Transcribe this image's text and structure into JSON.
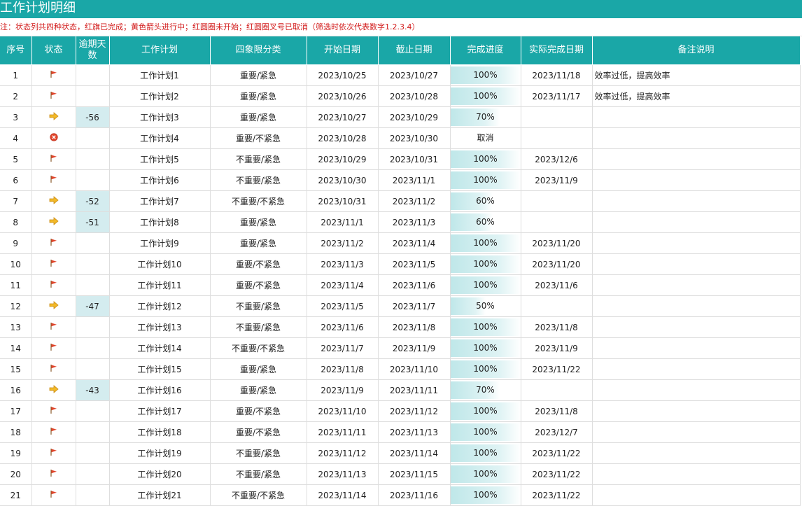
{
  "title": "工作计划明细",
  "note": "注：状态列共四种状态，红旗已完成；黄色箭头进行中；红圆圈未开始；红圆圈叉号已取消（筛选时依次代表数字1.2.3.4）",
  "headers": [
    "序号",
    "状态",
    "逾期天数",
    "工作计划",
    "四象限分类",
    "开始日期",
    "截止日期",
    "完成进度",
    "实际完成日期",
    "备注说明"
  ],
  "colors": {
    "header_bg": "#1aa7a7",
    "note_red": "#d21a1a",
    "overdue_bg": "#d4ecef",
    "progress_fill": "#bfe7e9"
  },
  "rows": [
    {
      "no": "1",
      "status": "flag-icon",
      "overdue": "",
      "plan": "工作计划1",
      "quadrant": "重要/紧急",
      "start": "2023/10/25",
      "end": "2023/10/27",
      "progress": "100%",
      "progress_value": 100,
      "actual": "2023/11/18",
      "remark": "效率过低，提高效率"
    },
    {
      "no": "2",
      "status": "flag-icon",
      "overdue": "",
      "plan": "工作计划2",
      "quadrant": "重要/紧急",
      "start": "2023/10/26",
      "end": "2023/10/28",
      "progress": "100%",
      "progress_value": 100,
      "actual": "2023/11/17",
      "remark": "效率过低，提高效率"
    },
    {
      "no": "3",
      "status": "arrow-icon",
      "overdue": "-56",
      "plan": "工作计划3",
      "quadrant": "重要/紧急",
      "start": "2023/10/27",
      "end": "2023/10/29",
      "progress": "70%",
      "progress_value": 70,
      "actual": "",
      "remark": ""
    },
    {
      "no": "4",
      "status": "cancel-icon",
      "overdue": "",
      "plan": "工作计划4",
      "quadrant": "重要/不紧急",
      "start": "2023/10/28",
      "end": "2023/10/30",
      "progress": "取消",
      "progress_value": 0,
      "actual": "",
      "remark": ""
    },
    {
      "no": "5",
      "status": "flag-icon",
      "overdue": "",
      "plan": "工作计划5",
      "quadrant": "不重要/紧急",
      "start": "2023/10/29",
      "end": "2023/10/31",
      "progress": "100%",
      "progress_value": 100,
      "actual": "2023/12/6",
      "remark": ""
    },
    {
      "no": "6",
      "status": "flag-icon",
      "overdue": "",
      "plan": "工作计划6",
      "quadrant": "不重要/紧急",
      "start": "2023/10/30",
      "end": "2023/11/1",
      "progress": "100%",
      "progress_value": 100,
      "actual": "2023/11/9",
      "remark": ""
    },
    {
      "no": "7",
      "status": "arrow-icon",
      "overdue": "-52",
      "plan": "工作计划7",
      "quadrant": "不重要/不紧急",
      "start": "2023/10/31",
      "end": "2023/11/2",
      "progress": "60%",
      "progress_value": 60,
      "actual": "",
      "remark": ""
    },
    {
      "no": "8",
      "status": "arrow-icon",
      "overdue": "-51",
      "plan": "工作计划8",
      "quadrant": "重要/紧急",
      "start": "2023/11/1",
      "end": "2023/11/3",
      "progress": "60%",
      "progress_value": 60,
      "actual": "",
      "remark": ""
    },
    {
      "no": "9",
      "status": "flag-icon",
      "overdue": "",
      "plan": "工作计划9",
      "quadrant": "重要/紧急",
      "start": "2023/11/2",
      "end": "2023/11/4",
      "progress": "100%",
      "progress_value": 100,
      "actual": "2023/11/20",
      "remark": ""
    },
    {
      "no": "10",
      "status": "flag-icon",
      "overdue": "",
      "plan": "工作计划10",
      "quadrant": "重要/不紧急",
      "start": "2023/11/3",
      "end": "2023/11/5",
      "progress": "100%",
      "progress_value": 100,
      "actual": "2023/11/20",
      "remark": ""
    },
    {
      "no": "11",
      "status": "flag-icon",
      "overdue": "",
      "plan": "工作计划11",
      "quadrant": "重要/不紧急",
      "start": "2023/11/4",
      "end": "2023/11/6",
      "progress": "100%",
      "progress_value": 100,
      "actual": "2023/11/6",
      "remark": ""
    },
    {
      "no": "12",
      "status": "arrow-icon",
      "overdue": "-47",
      "plan": "工作计划12",
      "quadrant": "不重要/紧急",
      "start": "2023/11/5",
      "end": "2023/11/7",
      "progress": "50%",
      "progress_value": 50,
      "actual": "",
      "remark": ""
    },
    {
      "no": "13",
      "status": "flag-icon",
      "overdue": "",
      "plan": "工作计划13",
      "quadrant": "不重要/紧急",
      "start": "2023/11/6",
      "end": "2023/11/8",
      "progress": "100%",
      "progress_value": 100,
      "actual": "2023/11/8",
      "remark": ""
    },
    {
      "no": "14",
      "status": "flag-icon",
      "overdue": "",
      "plan": "工作计划14",
      "quadrant": "不重要/不紧急",
      "start": "2023/11/7",
      "end": "2023/11/9",
      "progress": "100%",
      "progress_value": 100,
      "actual": "2023/11/9",
      "remark": ""
    },
    {
      "no": "15",
      "status": "flag-icon",
      "overdue": "",
      "plan": "工作计划15",
      "quadrant": "重要/紧急",
      "start": "2023/11/8",
      "end": "2023/11/10",
      "progress": "100%",
      "progress_value": 100,
      "actual": "2023/11/22",
      "remark": ""
    },
    {
      "no": "16",
      "status": "arrow-icon",
      "overdue": "-43",
      "plan": "工作计划16",
      "quadrant": "重要/紧急",
      "start": "2023/11/9",
      "end": "2023/11/11",
      "progress": "70%",
      "progress_value": 70,
      "actual": "",
      "remark": ""
    },
    {
      "no": "17",
      "status": "flag-icon",
      "overdue": "",
      "plan": "工作计划17",
      "quadrant": "重要/不紧急",
      "start": "2023/11/10",
      "end": "2023/11/12",
      "progress": "100%",
      "progress_value": 100,
      "actual": "2023/11/8",
      "remark": ""
    },
    {
      "no": "18",
      "status": "flag-icon",
      "overdue": "",
      "plan": "工作计划18",
      "quadrant": "重要/不紧急",
      "start": "2023/11/11",
      "end": "2023/11/13",
      "progress": "100%",
      "progress_value": 100,
      "actual": "2023/12/7",
      "remark": ""
    },
    {
      "no": "19",
      "status": "flag-icon",
      "overdue": "",
      "plan": "工作计划19",
      "quadrant": "不重要/紧急",
      "start": "2023/11/12",
      "end": "2023/11/14",
      "progress": "100%",
      "progress_value": 100,
      "actual": "2023/11/22",
      "remark": ""
    },
    {
      "no": "20",
      "status": "flag-icon",
      "overdue": "",
      "plan": "工作计划20",
      "quadrant": "不重要/紧急",
      "start": "2023/11/13",
      "end": "2023/11/15",
      "progress": "100%",
      "progress_value": 100,
      "actual": "2023/11/22",
      "remark": ""
    },
    {
      "no": "21",
      "status": "flag-icon",
      "overdue": "",
      "plan": "工作计划21",
      "quadrant": "不重要/不紧急",
      "start": "2023/11/14",
      "end": "2023/11/16",
      "progress": "100%",
      "progress_value": 100,
      "actual": "2023/11/22",
      "remark": ""
    }
  ]
}
